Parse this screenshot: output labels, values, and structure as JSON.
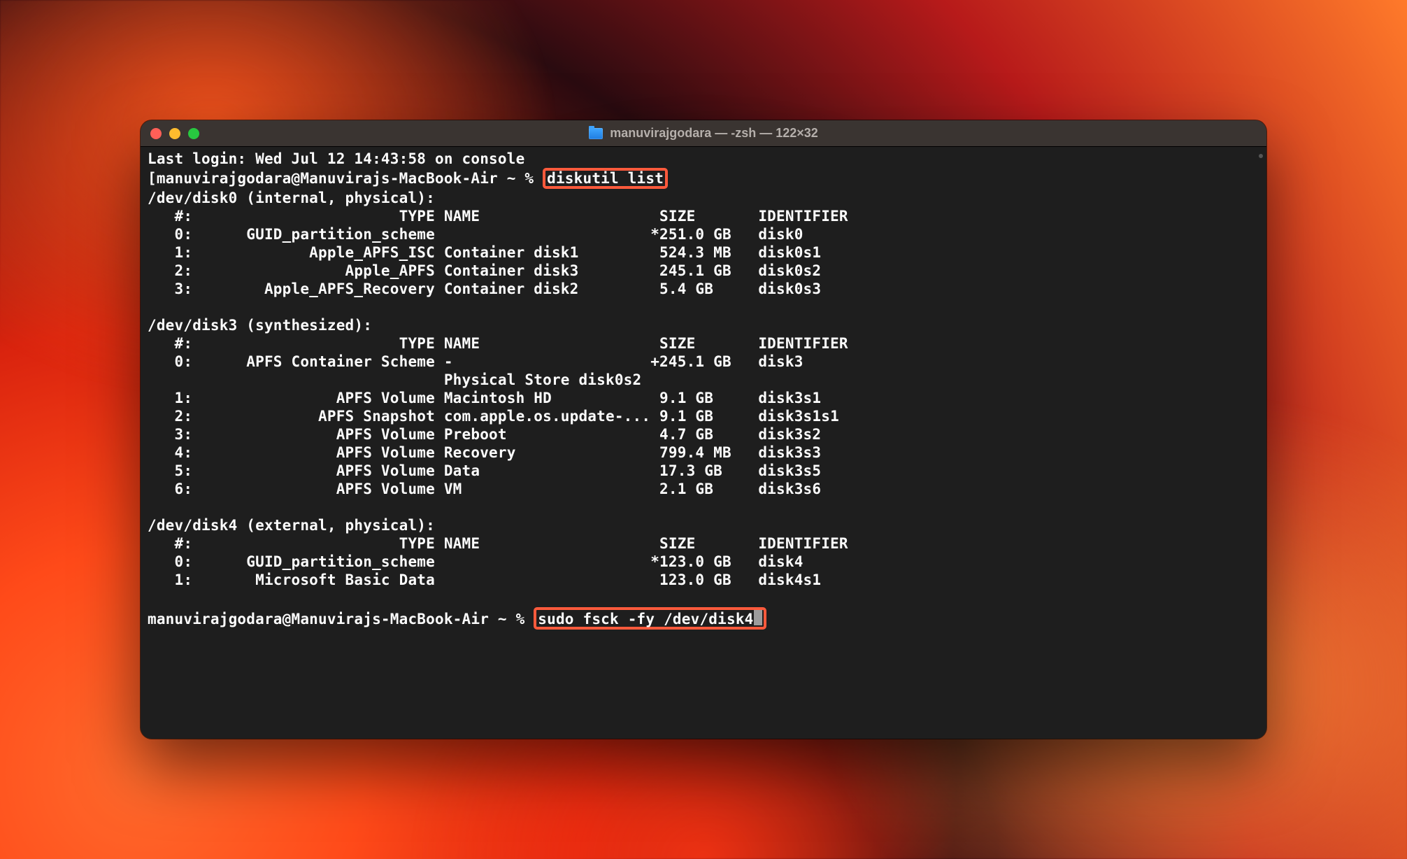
{
  "window": {
    "title": "manuvirajgodara — -zsh — 122×32"
  },
  "session": {
    "last_login": "Last login: Wed Jul 12 14:43:58 on console",
    "prompt1": "[manuvirajgodara@Manuvirajs-MacBook-Air ~ % ",
    "cmd1": "diskutil list",
    "prompt2": "manuvirajgodara@Manuvirajs-MacBook-Air ~ % ",
    "cmd2": "sudo fsck -fy /dev/disk4"
  },
  "disk0": {
    "header": "/dev/disk0 (internal, physical):",
    "cols": "   #:                       TYPE NAME                    SIZE       IDENTIFIER",
    "r0": "   0:      GUID_partition_scheme                        *251.0 GB   disk0",
    "r1": "   1:             Apple_APFS_ISC Container disk1         524.3 MB   disk0s1",
    "r2": "   2:                 Apple_APFS Container disk3         245.1 GB   disk0s2",
    "r3": "   3:        Apple_APFS_Recovery Container disk2         5.4 GB     disk0s3"
  },
  "disk3": {
    "header": "/dev/disk3 (synthesized):",
    "cols": "   #:                       TYPE NAME                    SIZE       IDENTIFIER",
    "r0": "   0:      APFS Container Scheme -                      +245.1 GB   disk3",
    "store": "                                 Physical Store disk0s2",
    "r1": "   1:                APFS Volume Macintosh HD            9.1 GB     disk3s1",
    "r2": "   2:              APFS Snapshot com.apple.os.update-... 9.1 GB     disk3s1s1",
    "r3": "   3:                APFS Volume Preboot                 4.7 GB     disk3s2",
    "r4": "   4:                APFS Volume Recovery                799.4 MB   disk3s3",
    "r5": "   5:                APFS Volume Data                    17.3 GB    disk3s5",
    "r6": "   6:                APFS Volume VM                      2.1 GB     disk3s6"
  },
  "disk4": {
    "header": "/dev/disk4 (external, physical):",
    "cols": "   #:                       TYPE NAME                    SIZE       IDENTIFIER",
    "r0": "   0:      GUID_partition_scheme                        *123.0 GB   disk4",
    "r1": "   1:       Microsoft Basic Data                         123.0 GB   disk4s1"
  }
}
